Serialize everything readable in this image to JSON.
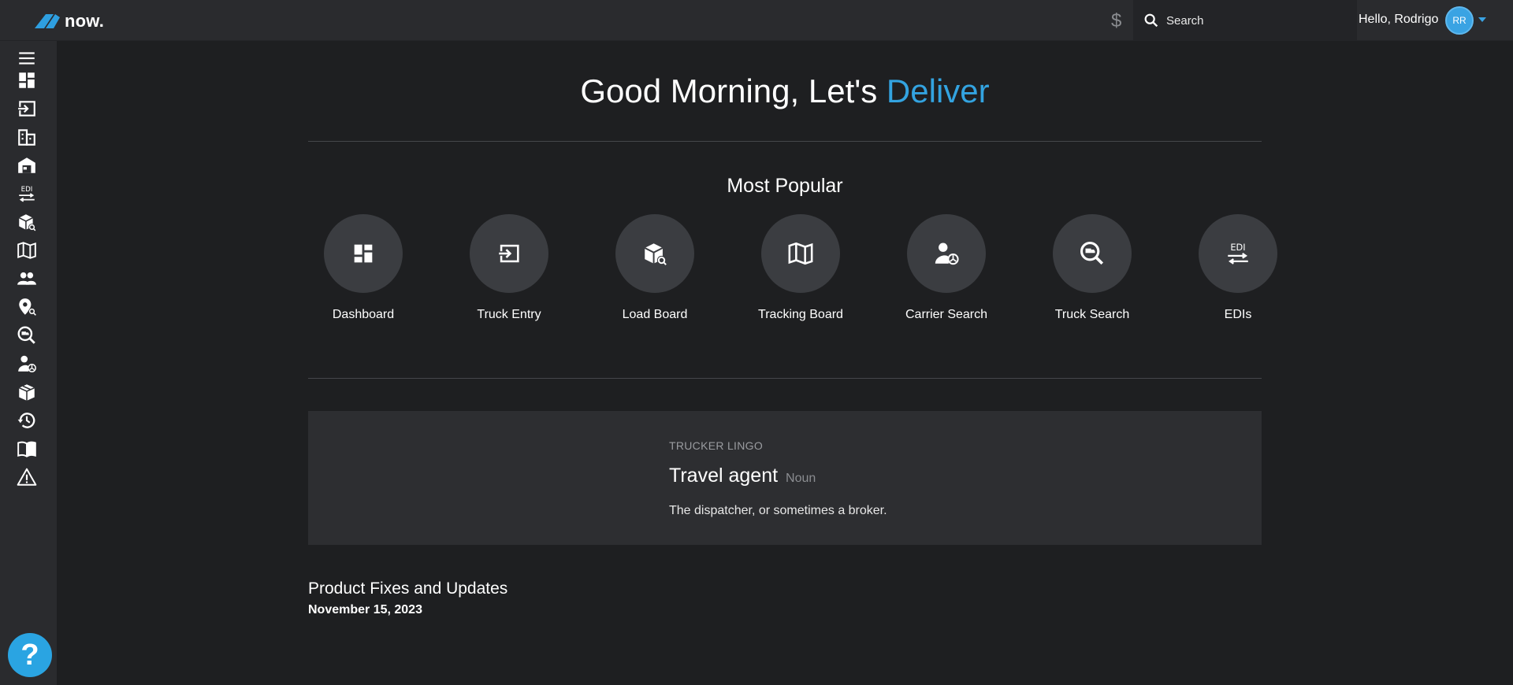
{
  "header": {
    "logo_text": "now.",
    "search_placeholder": "Search",
    "greeting": "Hello, Rodrigo",
    "avatar_initials": "RR",
    "currency_symbol": "$"
  },
  "sidebar": {
    "items": [
      {
        "icon": "menu-icon"
      },
      {
        "icon": "dashboard-icon"
      },
      {
        "icon": "truck-entry-icon"
      },
      {
        "icon": "building-icon"
      },
      {
        "icon": "warehouse-icon"
      },
      {
        "icon": "edi-icon"
      },
      {
        "icon": "load-board-icon"
      },
      {
        "icon": "map-icon"
      },
      {
        "icon": "people-icon"
      },
      {
        "icon": "location-search-icon"
      },
      {
        "icon": "truck-search-icon"
      },
      {
        "icon": "carrier-search-icon"
      },
      {
        "icon": "package-icon"
      },
      {
        "icon": "history-icon"
      },
      {
        "icon": "book-icon"
      },
      {
        "icon": "warning-icon"
      }
    ],
    "help_label": "?"
  },
  "main": {
    "headline_prefix": "Good Morning, Let's ",
    "headline_accent": "Deliver",
    "most_popular_title": "Most Popular",
    "tiles": [
      {
        "label": "Dashboard",
        "icon": "dashboard-icon"
      },
      {
        "label": "Truck Entry",
        "icon": "truck-entry-icon"
      },
      {
        "label": "Load Board",
        "icon": "load-board-icon"
      },
      {
        "label": "Tracking Board",
        "icon": "map-icon"
      },
      {
        "label": "Carrier Search",
        "icon": "carrier-search-icon"
      },
      {
        "label": "Truck Search",
        "icon": "truck-search-icon"
      },
      {
        "label": "EDIs",
        "icon": "edi-icon"
      }
    ],
    "lingo": {
      "kicker": "TRUCKER LINGO",
      "term": "Travel agent",
      "part_of_speech": "Noun",
      "definition": "The dispatcher, or sometimes a broker."
    },
    "updates": {
      "title": "Product Fixes and Updates",
      "date": "November 15, 2023"
    }
  },
  "colors": {
    "accent": "#33a3e0",
    "background": "#1e1f21",
    "sidebar": "#2a2b2e",
    "tile": "#3b3d41"
  }
}
